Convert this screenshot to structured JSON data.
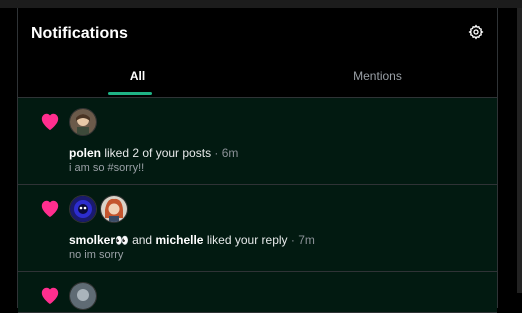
{
  "header": {
    "title": "Notifications"
  },
  "tabs": [
    {
      "label": "All",
      "active": true
    },
    {
      "label": "Mentions",
      "active": false
    }
  ],
  "notifications": [
    {
      "actor1": "polen",
      "action": "liked 2 of your posts",
      "time": "· 6m",
      "preview": "i am so #sorry!!"
    },
    {
      "actor1": "smolker",
      "actor1_emoji": "👀",
      "joiner": "and",
      "actor2": "michelle",
      "action": "liked your reply",
      "time": "· 7m",
      "preview": "no im sorry"
    }
  ],
  "colors": {
    "heart": "#ff2e8e",
    "accent": "#1fb386",
    "row_bg": "#021a11"
  },
  "icons": [
    "settings-gear-icon",
    "heart-icon"
  ]
}
